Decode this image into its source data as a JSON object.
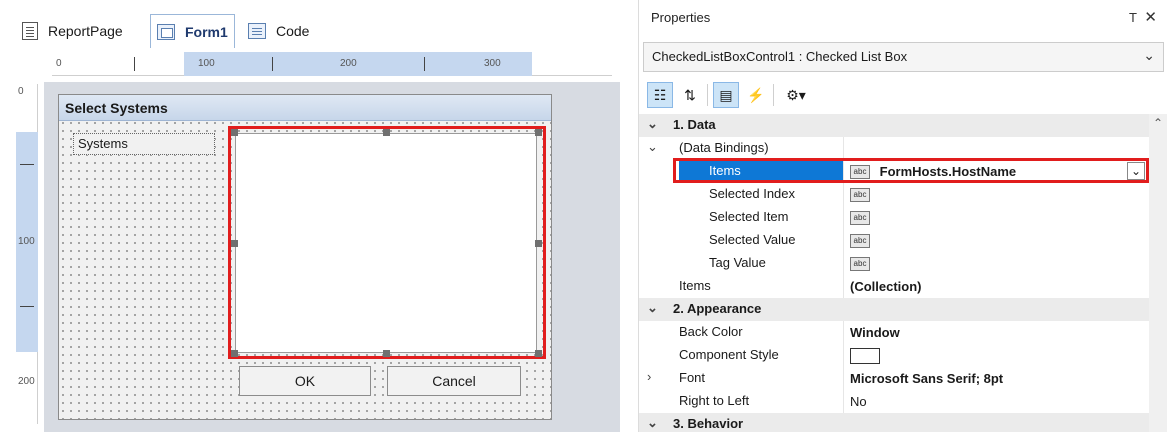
{
  "designer": {
    "tabs": [
      "ReportPage",
      "Form1",
      "Code"
    ],
    "ruler_h": [
      "0",
      "100",
      "200",
      "300"
    ],
    "ruler_v": [
      "0",
      "100",
      "200"
    ],
    "form": {
      "title": "Select Systems",
      "label": "Systems",
      "ok": "OK",
      "cancel": "Cancel"
    }
  },
  "properties": {
    "title": "Properties",
    "pin": "Т",
    "close": "✕",
    "object": "CheckedListBoxControl1 : Checked List Box",
    "toolbar": [
      "categorized-icon",
      "alphabetical-icon",
      "properties-icon",
      "events-icon",
      "gear-icon"
    ],
    "rows": {
      "cat_data": "1. Data",
      "data_bindings": "(Data Bindings)",
      "items_binding": "Items",
      "items_binding_value": "FormHosts.HostName",
      "selected_index": "Selected Index",
      "selected_item": "Selected Item",
      "selected_value": "Selected Value",
      "tag_value": "Tag Value",
      "items": "Items",
      "items_value": "(Collection)",
      "cat_appearance": "2. Appearance",
      "back_color": "Back Color",
      "back_color_value": "Window",
      "component_style": "Component Style",
      "font": "Font",
      "font_value": "Microsoft Sans Serif; 8pt",
      "rtl": "Right to Left",
      "rtl_value": "No",
      "cat_behavior": "3. Behavior",
      "abc": "abc"
    },
    "colors": {
      "selected": "#0e78d6",
      "highlight": "#e11d1d"
    }
  }
}
